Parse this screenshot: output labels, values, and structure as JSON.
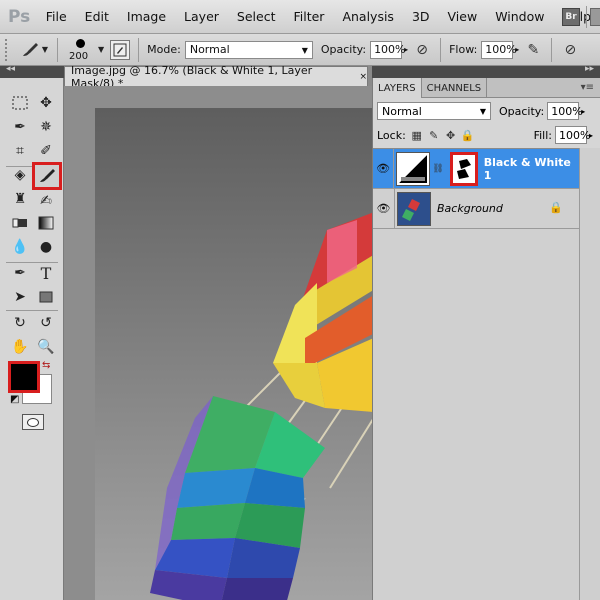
{
  "menubar": {
    "logo": "Ps",
    "items": [
      "File",
      "Edit",
      "Image",
      "Layer",
      "Select",
      "Filter",
      "Analysis",
      "3D",
      "View",
      "Window",
      "Help"
    ],
    "bridge": "Br"
  },
  "options": {
    "brush_size": "200",
    "mode_label": "Mode:",
    "mode_value": "Normal",
    "opacity_label": "Opacity:",
    "opacity_value": "100%",
    "flow_label": "Flow:",
    "flow_value": "100%"
  },
  "document": {
    "tab_title": "Image.jpg @ 16.7% (Black & White 1, Layer Mask/8) *",
    "close": "×"
  },
  "layers_panel": {
    "tabs": [
      "LAYERS",
      "CHANNELS"
    ],
    "blend_mode": "Normal",
    "opacity_label": "Opacity:",
    "opacity_value": "100%",
    "lock_label": "Lock:",
    "fill_label": "Fill:",
    "fill_value": "100%",
    "layers": [
      {
        "name": "Black & White 1",
        "selected": true
      },
      {
        "name": "Background",
        "selected": false
      }
    ]
  },
  "colors": {
    "accent_highlight": "#d81e1e",
    "selected_layer": "#3c8ee6",
    "foreground": "#000000",
    "background": "#ffffff"
  }
}
